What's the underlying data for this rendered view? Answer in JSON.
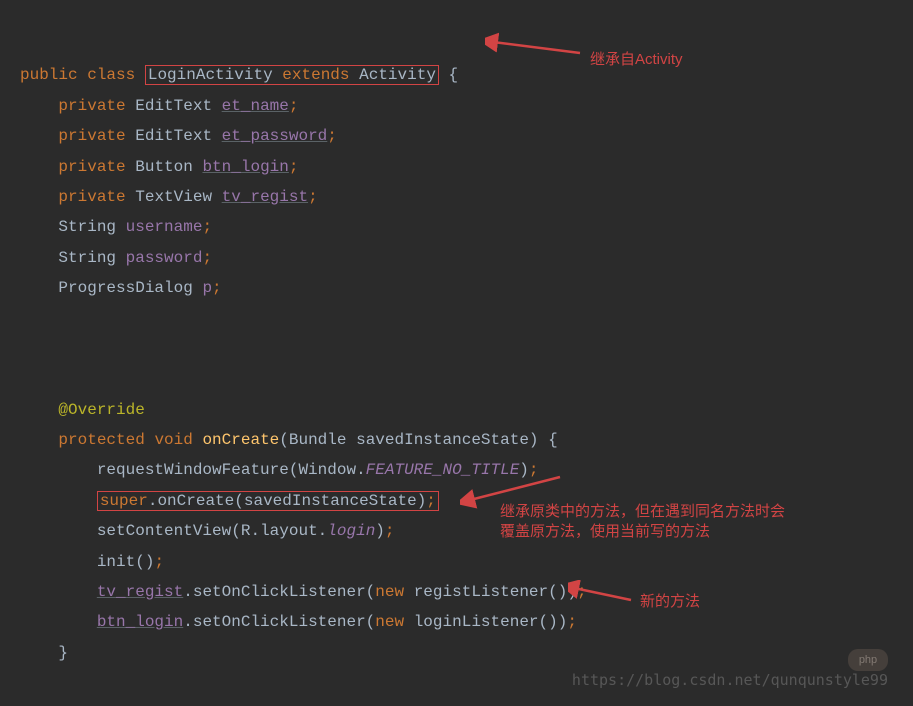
{
  "code": {
    "l1_public": "public",
    "l1_class": "class",
    "l1_name": "LoginActivity",
    "l1_extends": "extends",
    "l1_parent": "Activity",
    "l1_brace": "{",
    "l2_private": "private",
    "l2_type": "EditText",
    "l2_var": "et_name",
    "l3_private": "private",
    "l3_type": "EditText",
    "l3_var": "et_password",
    "l4_private": "private",
    "l4_type": "Button",
    "l4_var": "btn_login",
    "l5_private": "private",
    "l5_type": "TextView",
    "l5_var": "tv_regist",
    "l6_type": "String",
    "l6_var": "username",
    "l7_type": "String",
    "l7_var": "password",
    "l8_type": "ProgressDialog",
    "l8_var": "p",
    "l10_override": "@Override",
    "l11_protected": "protected",
    "l11_void": "void",
    "l11_method": "onCreate",
    "l11_argtype": "Bundle",
    "l11_argname": "savedInstanceState",
    "l11_brace": "{",
    "l12_call": "requestWindowFeature",
    "l12_win": "Window",
    "l12_const": "FEATURE_NO_TITLE",
    "l13_super": "super",
    "l13_method": "onCreate",
    "l13_arg": "savedInstanceState",
    "l14_call": "setContentView",
    "l14_r": "R",
    "l14_layout": "layout",
    "l14_login": "login",
    "l15_init": "init",
    "l16_var": "tv_regist",
    "l16_method": "setOnClickListener",
    "l16_new": "new",
    "l16_listener": "registListener",
    "l17_var": "btn_login",
    "l17_method": "setOnClickListener",
    "l17_new": "new",
    "l17_listener": "loginListener",
    "l18_brace": "}",
    "semi": ";",
    "dot": ".",
    "lp": "(",
    "rp": ")"
  },
  "annotations": {
    "a1": "继承自Activity",
    "a2_line1": "继承原类中的方法，但在遇到同名方法时会",
    "a2_line2": "覆盖原方法，使用当前写的方法",
    "a3": "新的方法"
  },
  "watermark": "https://blog.csdn.net/qunqunstyle99",
  "badge": "php"
}
